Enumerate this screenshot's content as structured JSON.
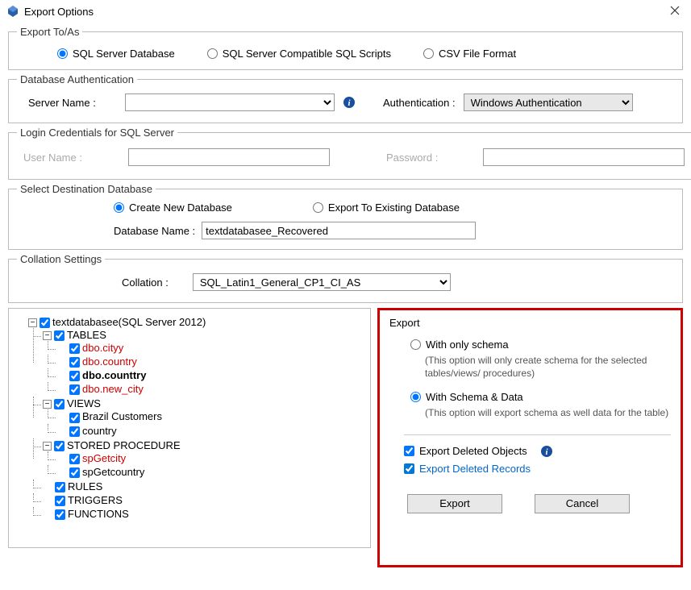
{
  "window": {
    "title": "Export Options"
  },
  "exportTo": {
    "legend": "Export To/As",
    "options": {
      "sqlserver": "SQL Server Database",
      "scripts": "SQL Server Compatible SQL Scripts",
      "csv": "CSV File Format"
    }
  },
  "auth": {
    "legend": "Database Authentication",
    "serverLabel": "Server Name :",
    "serverValue": "",
    "authLabel": "Authentication :",
    "authValue": "Windows Authentication"
  },
  "login": {
    "legend": "Login Credentials for SQL Server",
    "userLabel": "User Name :",
    "userValue": "",
    "passLabel": "Password :",
    "passValue": ""
  },
  "dest": {
    "legend": "Select Destination Database",
    "createLabel": "Create New Database",
    "existingLabel": "Export To Existing Database",
    "dbnameLabel": "Database Name :",
    "dbnameValue": "textdatabasee_Recovered"
  },
  "collation": {
    "legend": "Collation Settings",
    "label": "Collation :",
    "value": "SQL_Latin1_General_CP1_CI_AS"
  },
  "tree": {
    "root": "textdatabasee(SQL Server 2012)",
    "tables": "TABLES",
    "tableItems": {
      "cityy": "dbo.cityy",
      "country": "dbo.country",
      "counttry": "dbo.counttry",
      "newcity": "dbo.new_city"
    },
    "views": "VIEWS",
    "viewItems": {
      "brazil": "Brazil Customers",
      "country": "country"
    },
    "sp": "STORED PROCEDURE",
    "spItems": {
      "getcity": "spGetcity",
      "getcountry": "spGetcountry"
    },
    "rules": "RULES",
    "triggers": "TRIGGERS",
    "functions": "FUNCTIONS"
  },
  "export": {
    "title": "Export",
    "schemaOnly": "With only schema",
    "schemaOnlyDesc": "(This option will only create schema for the  selected tables/views/ procedures)",
    "schemaData": "With Schema & Data",
    "schemaDataDesc": "(This option will export schema as well data for the table)",
    "deletedObjects": "Export Deleted Objects",
    "deletedRecords": "Export Deleted Records",
    "exportBtn": "Export",
    "cancelBtn": "Cancel"
  }
}
